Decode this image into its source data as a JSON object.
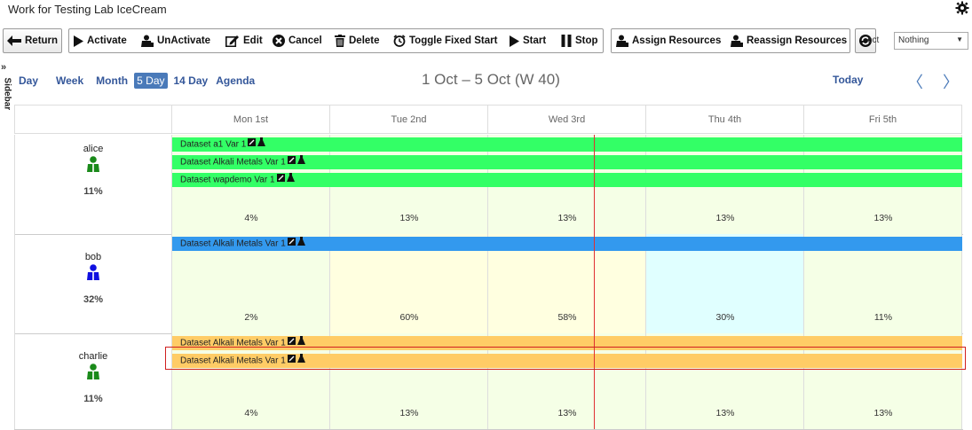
{
  "window": {
    "title": "Work for Testing Lab IceCream",
    "gear_icon": "gear-icon"
  },
  "toolbar": {
    "return_label": "Return",
    "activate_label": "Activate",
    "unactivate_label": "UnActivate",
    "edit_label": "Edit",
    "cancel_label": "Cancel",
    "delete_label": "Delete",
    "toggle_label": "Toggle Fixed Start",
    "start_label": "Start",
    "stop_label": "Stop",
    "assign_label": "Assign Resources",
    "reassign_label": "Reassign Resources",
    "select_label": "ect",
    "select_value": "Nothing"
  },
  "sidebar": {
    "label": "Sidebar"
  },
  "views": {
    "day": "Day",
    "week": "Week",
    "month": "Month",
    "five_day": "5 Day",
    "fourteen_day": "14 Day",
    "agenda": "Agenda",
    "active": "5 Day"
  },
  "calendar": {
    "range": "1 Oct – 5 Oct (W 40)",
    "today": "Today",
    "days": [
      "Mon 1st",
      "Tue 2nd",
      "Wed 3rd",
      "Thu 4th",
      "Fri 5th"
    ]
  },
  "resources": [
    {
      "name": "alice",
      "utilization": "11%",
      "icon_color": "#1a8a1a",
      "tasks": [
        "Dataset a1 Var 1",
        "Dataset Alkali Metals Var 1",
        "Dataset wapdemo Var 1"
      ],
      "task_color": "#33ff66",
      "day_load": [
        "4%",
        "13%",
        "13%",
        "13%",
        "13%"
      ],
      "day_colors": [
        "#f5ffe6",
        "#f5ffe6",
        "#f5ffe6",
        "#f5ffe6",
        "#f5ffe6"
      ]
    },
    {
      "name": "bob",
      "utilization": "32%",
      "icon_color": "#1010e0",
      "tasks": [
        "Dataset Alkali Metals Var 1"
      ],
      "task_color": "#3399ee",
      "day_load": [
        "2%",
        "60%",
        "58%",
        "30%",
        "11%"
      ],
      "day_colors": [
        "#f5ffe6",
        "#ffffe0",
        "#ffffe0",
        "#e0ffff",
        "#f5ffe6"
      ]
    },
    {
      "name": "charlie",
      "utilization": "11%",
      "icon_color": "#1a8a1a",
      "tasks": [
        "Dataset Alkali Metals Var 1",
        "Dataset Alkali Metals Var 1"
      ],
      "task_color": "#ffcc66",
      "day_load": [
        "4%",
        "13%",
        "13%",
        "13%",
        "13%"
      ],
      "day_colors": [
        "#f5ffe6",
        "#f5ffe6",
        "#f5ffe6",
        "#f5ffe6",
        "#f5ffe6"
      ]
    }
  ]
}
